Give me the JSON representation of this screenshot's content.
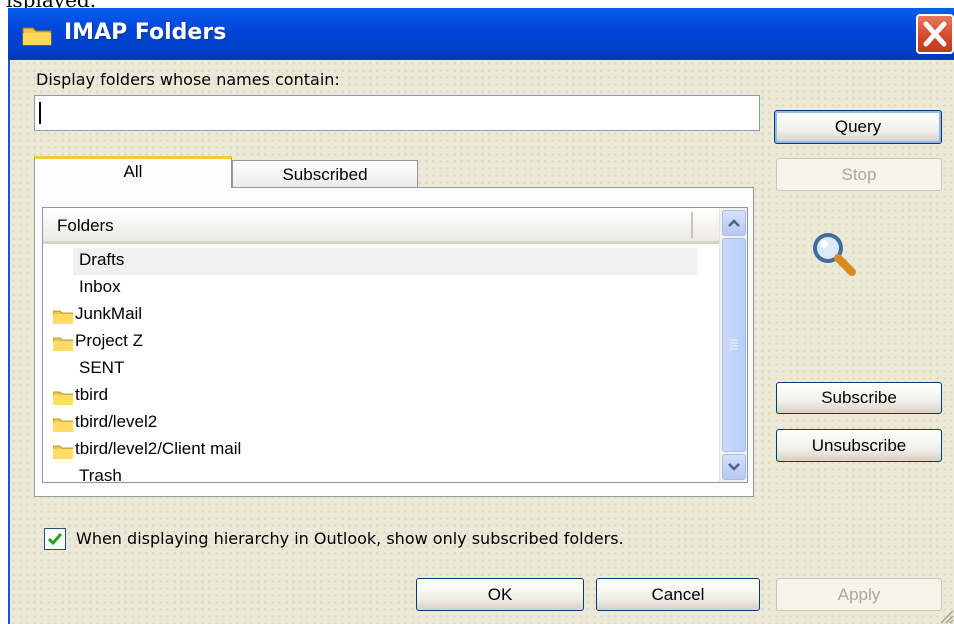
{
  "caption_fragment": "isplayed.",
  "window": {
    "title": "IMAP Folders",
    "title_icon": "folder-icon",
    "close_icon": "close-icon"
  },
  "filter": {
    "label": "Display folders whose names contain:",
    "value": ""
  },
  "buttons": {
    "query": "Query",
    "stop": "Stop",
    "subscribe": "Subscribe",
    "unsubscribe": "Unsubscribe",
    "ok": "OK",
    "cancel": "Cancel",
    "apply": "Apply"
  },
  "search_icon": "magnifier-icon",
  "tabs": [
    {
      "label": "All",
      "active": true
    },
    {
      "label": "Subscribed",
      "active": false
    }
  ],
  "list": {
    "column_header": "Folders",
    "rows": [
      {
        "label": "Drafts",
        "icon": "",
        "selected": true
      },
      {
        "label": "Inbox",
        "icon": ""
      },
      {
        "label": "JunkMail",
        "icon": "folder-icon"
      },
      {
        "label": "Project Z",
        "icon": "folder-icon"
      },
      {
        "label": "SENT",
        "icon": ""
      },
      {
        "label": "tbird",
        "icon": "folder-icon"
      },
      {
        "label": "tbird/level2",
        "icon": "folder-icon"
      },
      {
        "label": "tbird/level2/Client mail",
        "icon": "folder-icon"
      },
      {
        "label": "Trash",
        "icon": ""
      }
    ]
  },
  "checkbox": {
    "label": "When displaying hierarchy in Outlook, show only subscribed folders.",
    "checked": true
  },
  "colors": {
    "titlebar": "#0046d8",
    "dialog_bg": "#ece9d8",
    "close_button": "#d5462a",
    "checkmark": "#21a121"
  }
}
